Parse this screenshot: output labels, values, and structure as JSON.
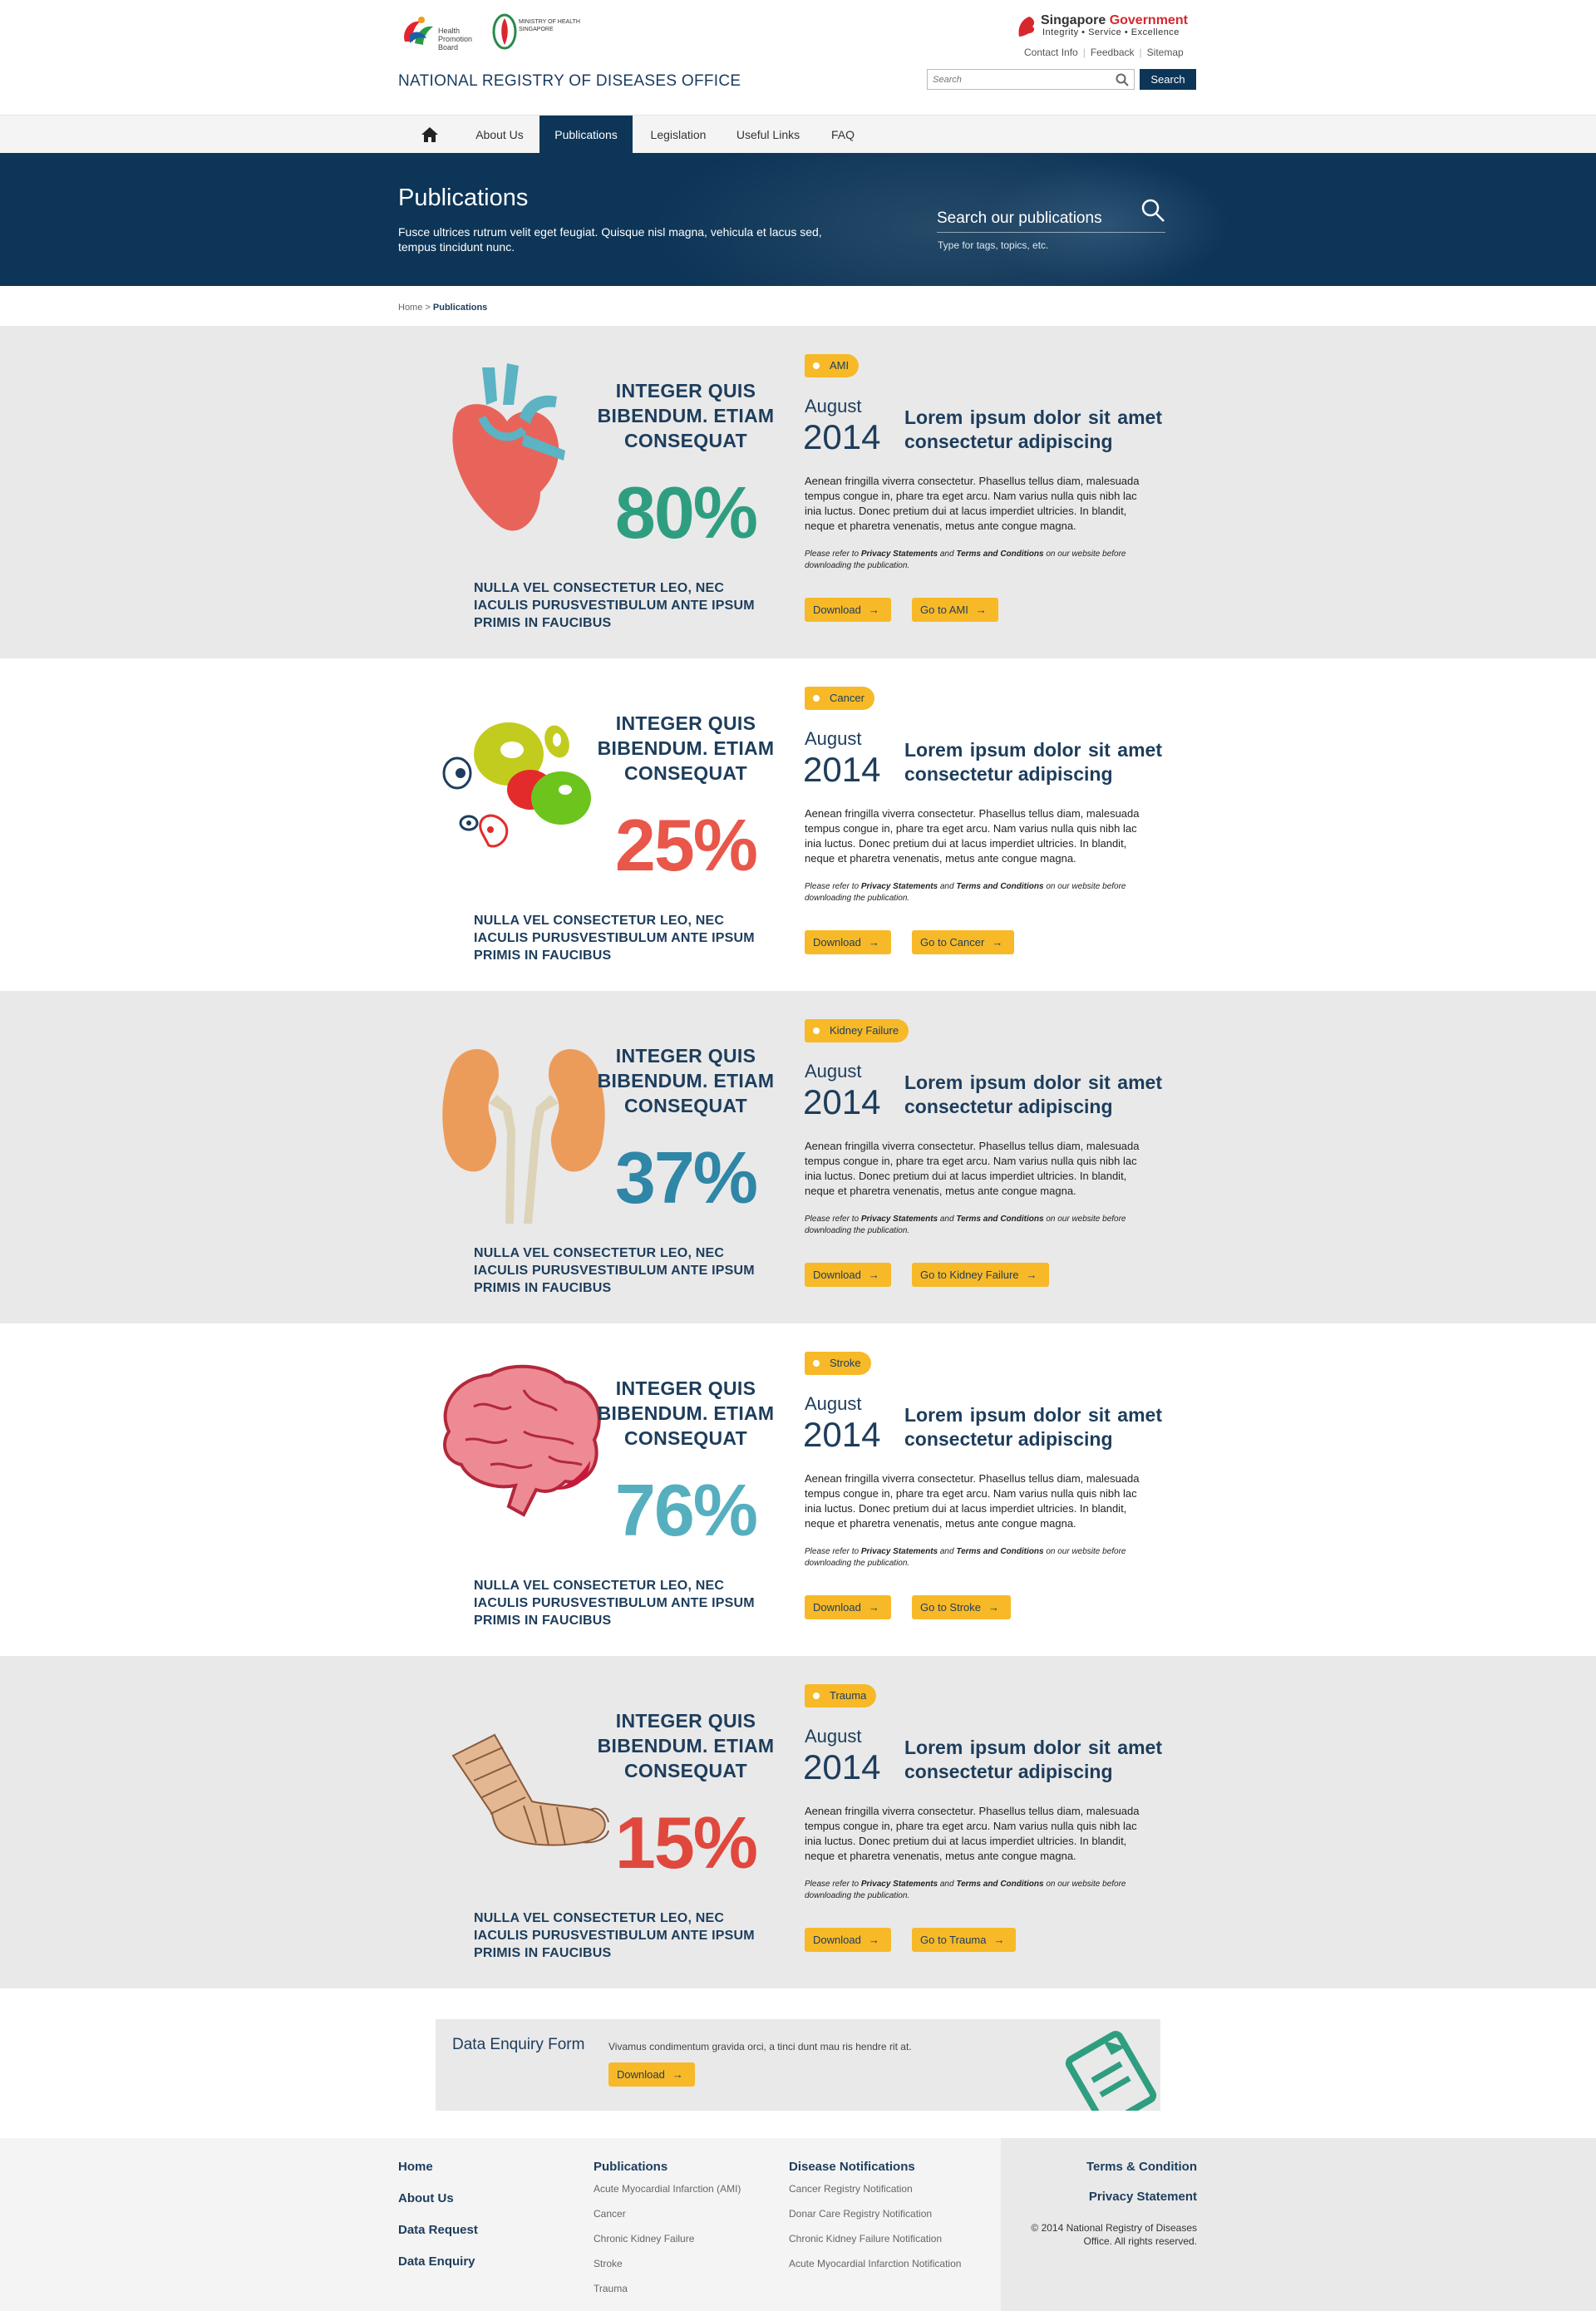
{
  "header": {
    "hpb_logo_text": "Health Promotion Board",
    "moh_logo_text": "MINISTRY OF HEALTH SINGAPORE",
    "site_title": "NATIONAL REGISTRY OF DISEASES OFFICE",
    "sg_gov_title_1": "Singapore",
    "sg_gov_title_2": "Government",
    "sg_gov_tagline": "Integrity • Service • Excellence",
    "links": [
      "Contact Info",
      "Feedback",
      "Sitemap"
    ],
    "search_placeholder": "Search",
    "search_button": "Search"
  },
  "nav": {
    "home_icon": "home-icon",
    "items": [
      "About Us",
      "Publications",
      "Legislation",
      "Useful Links",
      "FAQ"
    ],
    "active": "Publications"
  },
  "banner": {
    "title": "Publications",
    "subtitle": "Fusce ultrices rutrum velit eget feugiat. Quisque nisl magna, vehicula et lacus sed, tempus tincidunt nunc.",
    "search_placeholder": "Search our publications",
    "search_hint": "Type for tags, topics, etc."
  },
  "breadcrumb": {
    "home": "Home",
    "sep": ">",
    "current": "Publications"
  },
  "publications": [
    {
      "tag": "AMI",
      "icon": "heart-icon",
      "stat_heading": "INTEGER QUIS BIBENDUM. ETIAM CONSEQUAT",
      "stat_value": "80%",
      "stat_color": "#2f9e80",
      "stat_footer": "NULLA VEL CONSECTETUR LEO, NEC IACULIS PURUSVESTIBULUM ANTE IPSUM PRIMIS IN FAUCIBUS",
      "month": "August",
      "year": "2014",
      "title": "Lorem ipsum dolor sit amet consectetur adipiscing",
      "description": "Aenean fringilla viverra consectetur. Phasellus tellus diam, malesuada tempus congue in, phare tra eget arcu. Nam varius nulla quis nibh lac inia luctus. Donec pretium dui at lacus imperdiet ultricies. In blandit, neque et pharetra venenatis, metus ante congue magna.",
      "note_1": "Please refer to ",
      "note_privacy": "Privacy Statements",
      "note_and": " and ",
      "note_terms": "Terms and Conditions",
      "note_2": " on our website before downloading the publication.",
      "download_label": "Download",
      "goto_label": "Go to AMI"
    },
    {
      "tag": "Cancer",
      "icon": "cells-icon",
      "stat_heading": "INTEGER QUIS BIBENDUM. ETIAM CONSEQUAT",
      "stat_value": "25%",
      "stat_color": "#e8574a",
      "stat_footer": "NULLA VEL CONSECTETUR LEO, NEC IACULIS PURUSVESTIBULUM ANTE IPSUM PRIMIS IN FAUCIBUS",
      "month": "August",
      "year": "2014",
      "title": "Lorem ipsum dolor sit amet consectetur adipiscing",
      "description": "Aenean fringilla viverra consectetur. Phasellus tellus diam, malesuada tempus congue in, phare tra eget arcu. Nam varius nulla quis nibh lac inia luctus. Donec pretium dui at lacus imperdiet ultricies. In blandit, neque et pharetra venenatis, metus ante congue magna.",
      "note_1": "Please refer to ",
      "note_privacy": "Privacy Statements",
      "note_and": " and ",
      "note_terms": "Terms and Conditions",
      "note_2": " on our website before downloading the publication.",
      "download_label": "Download",
      "goto_label": "Go to Cancer"
    },
    {
      "tag": "Kidney Failure",
      "icon": "kidneys-icon",
      "stat_heading": "INTEGER QUIS BIBENDUM. ETIAM CONSEQUAT",
      "stat_value": "37%",
      "stat_color": "#2f86a6",
      "stat_footer": "NULLA VEL CONSECTETUR LEO, NEC IACULIS PURUSVESTIBULUM ANTE IPSUM PRIMIS IN FAUCIBUS",
      "month": "August",
      "year": "2014",
      "title": "Lorem ipsum dolor sit amet consectetur adipiscing",
      "description": "Aenean fringilla viverra consectetur. Phasellus tellus diam, malesuada tempus congue in, phare tra eget arcu. Nam varius nulla quis nibh lac inia luctus. Donec pretium dui at lacus imperdiet ultricies. In blandit, neque et pharetra venenatis, metus ante congue magna.",
      "note_1": "Please refer to ",
      "note_privacy": "Privacy Statements",
      "note_and": " and ",
      "note_terms": "Terms and Conditions",
      "note_2": " on our website before downloading the publication.",
      "download_label": "Download",
      "goto_label": "Go to Kidney Failure"
    },
    {
      "tag": "Stroke",
      "icon": "brain-icon",
      "stat_heading": "INTEGER QUIS BIBENDUM. ETIAM CONSEQUAT",
      "stat_value": "76%",
      "stat_color": "#56afbf",
      "stat_footer": "NULLA VEL CONSECTETUR LEO, NEC IACULIS PURUSVESTIBULUM ANTE IPSUM PRIMIS IN FAUCIBUS",
      "month": "August",
      "year": "2014",
      "title": "Lorem ipsum dolor sit amet consectetur adipiscing",
      "description": "Aenean fringilla viverra consectetur. Phasellus tellus diam, malesuada tempus congue in, phare tra eget arcu. Nam varius nulla quis nibh lac inia luctus. Donec pretium dui at lacus imperdiet ultricies. In blandit, neque et pharetra venenatis, metus ante congue magna.",
      "note_1": "Please refer to ",
      "note_privacy": "Privacy Statements",
      "note_and": " and ",
      "note_terms": "Terms and Conditions",
      "note_2": " on our website before downloading the publication.",
      "download_label": "Download",
      "goto_label": "Go to Stroke"
    },
    {
      "tag": "Trauma",
      "icon": "bandaged-foot-icon",
      "stat_heading": "INTEGER QUIS BIBENDUM. ETIAM CONSEQUAT",
      "stat_value": "15%",
      "stat_color": "#e0483d",
      "stat_footer": "NULLA VEL CONSECTETUR LEO, NEC IACULIS PURUSVESTIBULUM ANTE IPSUM PRIMIS IN FAUCIBUS",
      "month": "August",
      "year": "2014",
      "title": "Lorem ipsum dolor sit amet consectetur adipiscing",
      "description": "Aenean fringilla viverra consectetur. Phasellus tellus diam, malesuada tempus congue in, phare tra eget arcu. Nam varius nulla quis nibh lac inia luctus. Donec pretium dui at lacus imperdiet ultricies. In blandit, neque et pharetra venenatis, metus ante congue magna.",
      "note_1": "Please refer to ",
      "note_privacy": "Privacy Statements",
      "note_and": " and ",
      "note_terms": "Terms and Conditions",
      "note_2": " on our website before downloading the publication.",
      "download_label": "Download",
      "goto_label": "Go to Trauma"
    }
  ],
  "enquiry": {
    "title": "Data Enquiry Form",
    "text": "Vivamus condimentum gravida orci, a tinci dunt mau ris hendre rit at.",
    "button": "Download",
    "icon": "form-document-icon"
  },
  "footer": {
    "main_links": [
      "Home",
      "About Us",
      "Data Request",
      "Data Enquiry"
    ],
    "publications_heading": "Publications",
    "publications_links": [
      "Acute Myocardial Infarction (AMI)",
      "Cancer",
      "Chronic Kidney Failure",
      "Stroke",
      "Trauma"
    ],
    "notifications_heading": "Disease Notifications",
    "notifications_links": [
      "Cancer Registry Notification",
      "Donar Care Registry Notification",
      "Chronic Kidney Failure Notification",
      "Acute Myocardial Infarction Notification"
    ],
    "terms": "Terms & Condition",
    "privacy": "Privacy Statement",
    "copyright": "© 2014 National Registry of Diseases Office. All rights reserved."
  },
  "colors": {
    "navy": "#0d3557",
    "accent_yellow": "#f7b928",
    "grey_band": "#e9e9e9"
  }
}
